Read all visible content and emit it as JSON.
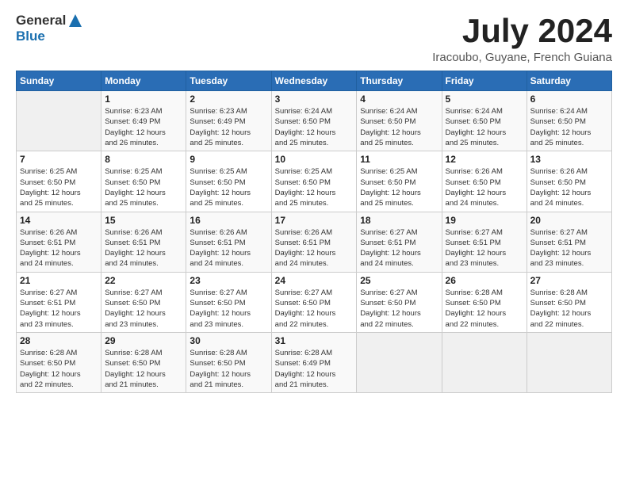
{
  "header": {
    "logo_general": "General",
    "logo_blue": "Blue",
    "month_title": "July 2024",
    "location": "Iracoubo, Guyane, French Guiana"
  },
  "days_of_week": [
    "Sunday",
    "Monday",
    "Tuesday",
    "Wednesday",
    "Thursday",
    "Friday",
    "Saturday"
  ],
  "weeks": [
    [
      {
        "day": "",
        "info": ""
      },
      {
        "day": "1",
        "info": "Sunrise: 6:23 AM\nSunset: 6:49 PM\nDaylight: 12 hours\nand 26 minutes."
      },
      {
        "day": "2",
        "info": "Sunrise: 6:23 AM\nSunset: 6:49 PM\nDaylight: 12 hours\nand 25 minutes."
      },
      {
        "day": "3",
        "info": "Sunrise: 6:24 AM\nSunset: 6:50 PM\nDaylight: 12 hours\nand 25 minutes."
      },
      {
        "day": "4",
        "info": "Sunrise: 6:24 AM\nSunset: 6:50 PM\nDaylight: 12 hours\nand 25 minutes."
      },
      {
        "day": "5",
        "info": "Sunrise: 6:24 AM\nSunset: 6:50 PM\nDaylight: 12 hours\nand 25 minutes."
      },
      {
        "day": "6",
        "info": "Sunrise: 6:24 AM\nSunset: 6:50 PM\nDaylight: 12 hours\nand 25 minutes."
      }
    ],
    [
      {
        "day": "7",
        "info": "Sunrise: 6:25 AM\nSunset: 6:50 PM\nDaylight: 12 hours\nand 25 minutes."
      },
      {
        "day": "8",
        "info": "Sunrise: 6:25 AM\nSunset: 6:50 PM\nDaylight: 12 hours\nand 25 minutes."
      },
      {
        "day": "9",
        "info": "Sunrise: 6:25 AM\nSunset: 6:50 PM\nDaylight: 12 hours\nand 25 minutes."
      },
      {
        "day": "10",
        "info": "Sunrise: 6:25 AM\nSunset: 6:50 PM\nDaylight: 12 hours\nand 25 minutes."
      },
      {
        "day": "11",
        "info": "Sunrise: 6:25 AM\nSunset: 6:50 PM\nDaylight: 12 hours\nand 25 minutes."
      },
      {
        "day": "12",
        "info": "Sunrise: 6:26 AM\nSunset: 6:50 PM\nDaylight: 12 hours\nand 24 minutes."
      },
      {
        "day": "13",
        "info": "Sunrise: 6:26 AM\nSunset: 6:50 PM\nDaylight: 12 hours\nand 24 minutes."
      }
    ],
    [
      {
        "day": "14",
        "info": "Sunrise: 6:26 AM\nSunset: 6:51 PM\nDaylight: 12 hours\nand 24 minutes."
      },
      {
        "day": "15",
        "info": "Sunrise: 6:26 AM\nSunset: 6:51 PM\nDaylight: 12 hours\nand 24 minutes."
      },
      {
        "day": "16",
        "info": "Sunrise: 6:26 AM\nSunset: 6:51 PM\nDaylight: 12 hours\nand 24 minutes."
      },
      {
        "day": "17",
        "info": "Sunrise: 6:26 AM\nSunset: 6:51 PM\nDaylight: 12 hours\nand 24 minutes."
      },
      {
        "day": "18",
        "info": "Sunrise: 6:27 AM\nSunset: 6:51 PM\nDaylight: 12 hours\nand 24 minutes."
      },
      {
        "day": "19",
        "info": "Sunrise: 6:27 AM\nSunset: 6:51 PM\nDaylight: 12 hours\nand 23 minutes."
      },
      {
        "day": "20",
        "info": "Sunrise: 6:27 AM\nSunset: 6:51 PM\nDaylight: 12 hours\nand 23 minutes."
      }
    ],
    [
      {
        "day": "21",
        "info": "Sunrise: 6:27 AM\nSunset: 6:51 PM\nDaylight: 12 hours\nand 23 minutes."
      },
      {
        "day": "22",
        "info": "Sunrise: 6:27 AM\nSunset: 6:50 PM\nDaylight: 12 hours\nand 23 minutes."
      },
      {
        "day": "23",
        "info": "Sunrise: 6:27 AM\nSunset: 6:50 PM\nDaylight: 12 hours\nand 23 minutes."
      },
      {
        "day": "24",
        "info": "Sunrise: 6:27 AM\nSunset: 6:50 PM\nDaylight: 12 hours\nand 22 minutes."
      },
      {
        "day": "25",
        "info": "Sunrise: 6:27 AM\nSunset: 6:50 PM\nDaylight: 12 hours\nand 22 minutes."
      },
      {
        "day": "26",
        "info": "Sunrise: 6:28 AM\nSunset: 6:50 PM\nDaylight: 12 hours\nand 22 minutes."
      },
      {
        "day": "27",
        "info": "Sunrise: 6:28 AM\nSunset: 6:50 PM\nDaylight: 12 hours\nand 22 minutes."
      }
    ],
    [
      {
        "day": "28",
        "info": "Sunrise: 6:28 AM\nSunset: 6:50 PM\nDaylight: 12 hours\nand 22 minutes."
      },
      {
        "day": "29",
        "info": "Sunrise: 6:28 AM\nSunset: 6:50 PM\nDaylight: 12 hours\nand 21 minutes."
      },
      {
        "day": "30",
        "info": "Sunrise: 6:28 AM\nSunset: 6:50 PM\nDaylight: 12 hours\nand 21 minutes."
      },
      {
        "day": "31",
        "info": "Sunrise: 6:28 AM\nSunset: 6:49 PM\nDaylight: 12 hours\nand 21 minutes."
      },
      {
        "day": "",
        "info": ""
      },
      {
        "day": "",
        "info": ""
      },
      {
        "day": "",
        "info": ""
      }
    ]
  ]
}
